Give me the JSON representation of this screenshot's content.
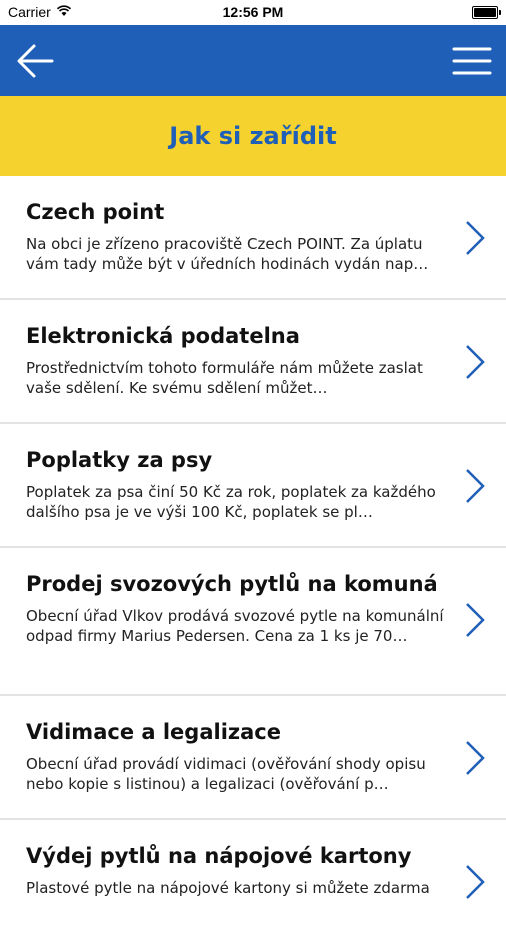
{
  "status": {
    "carrier": "Carrier",
    "time": "12:56 PM"
  },
  "header": {
    "title": "Jak si zařídit"
  },
  "icons": {
    "back": "arrow-left-icon",
    "menu": "hamburger-menu-icon",
    "chevron": "chevron-right-icon",
    "wifi": "wifi-icon",
    "battery": "battery-icon"
  },
  "colors": {
    "nav": "#1f5fb8",
    "title_bar": "#f6d22f",
    "accent": "#1f5fb8"
  },
  "items": [
    {
      "title": "Czech point",
      "desc": "Na obci je zřízeno pracoviště Czech POINT. Za úplatu vám tady může být v úředních hodinách vydán nap…"
    },
    {
      "title": "Elektronická podatelna",
      "desc": "Prostřednictvím tohoto formuláře nám můžete zaslat vaše sdělení. Ke svému sdělení můžet…"
    },
    {
      "title": "Poplatky za psy",
      "desc": "Poplatek za psa činí 50 Kč za rok, poplatek za každého dalšího psa je ve výši 100 Kč, poplatek se pl…"
    },
    {
      "title": "Prodej svozových pytlů na komunál…",
      "desc": "Obecní úřad Vlkov prodává svozové pytle na komunální odpad firmy Marius Pedersen. Cena za 1 ks je 70…"
    },
    {
      "title": "Vidimace a legalizace",
      "desc": "Obecní úřad provádí vidimaci (ověřování shody opisu nebo kopie s listinou) a legalizaci (ověřování p…"
    },
    {
      "title": "Výdej pytlů na nápojové kartony",
      "desc": "Plastové pytle na nápojové kartony si můžete zdarma"
    }
  ]
}
